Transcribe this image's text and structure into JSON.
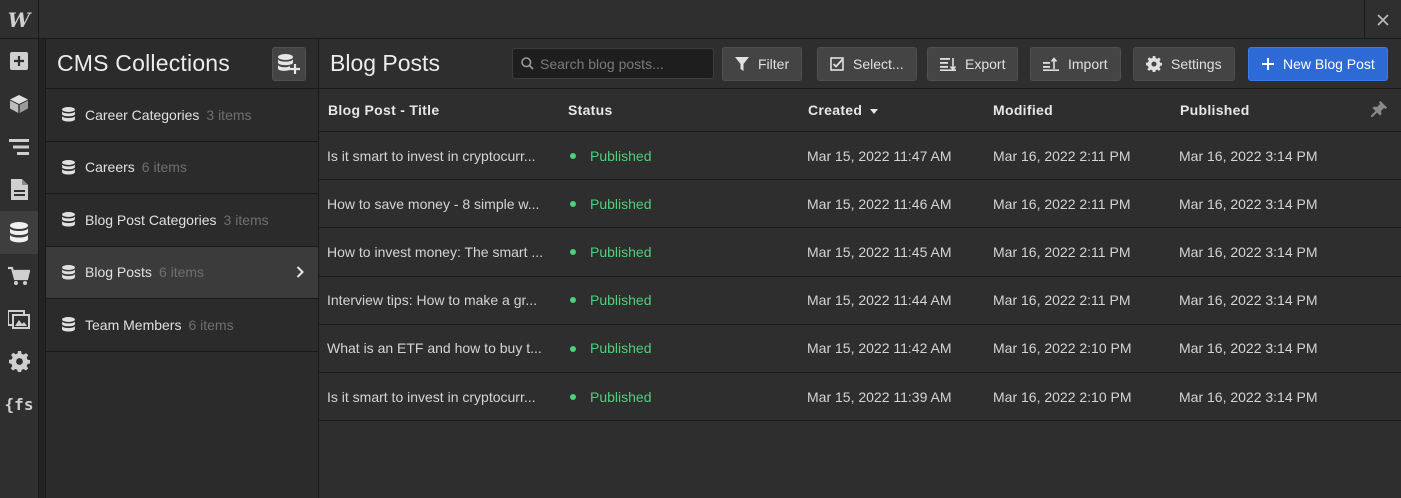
{
  "colors": {
    "accent": "#2d6ad6",
    "published": "#4cd07d"
  },
  "topbar": {
    "logo": "W",
    "close_icon": "close-icon"
  },
  "rail": {
    "items": [
      {
        "name": "add-icon"
      },
      {
        "name": "cube-icon"
      },
      {
        "name": "navigator-icon"
      },
      {
        "name": "page-icon"
      },
      {
        "name": "database-icon",
        "active": true
      },
      {
        "name": "cart-icon"
      },
      {
        "name": "images-icon"
      },
      {
        "name": "gear-icon"
      },
      {
        "name": "fs-icon",
        "label": "{fs"
      }
    ]
  },
  "collections": {
    "title": "CMS Collections",
    "items": [
      {
        "name": "Career Categories",
        "count": "3 items"
      },
      {
        "name": "Careers",
        "count": "6 items"
      },
      {
        "name": "Blog Post Categories",
        "count": "3 items"
      },
      {
        "name": "Blog Posts",
        "count": "6 items",
        "selected": true
      },
      {
        "name": "Team Members",
        "count": "6 items"
      }
    ]
  },
  "main": {
    "title": "Blog Posts",
    "search": {
      "placeholder": "Search blog posts...",
      "value": ""
    },
    "toolbar": {
      "filter": "Filter",
      "select": "Select...",
      "export": "Export",
      "import": "Import",
      "settings": "Settings",
      "new": "New Blog Post"
    },
    "table": {
      "headers": {
        "title": "Blog Post - Title",
        "status": "Status",
        "created": "Created",
        "modified": "Modified",
        "published": "Published"
      },
      "rows": [
        {
          "title": "Is it smart to invest in cryptocurr...",
          "status": "Published",
          "created": "Mar 15, 2022 11:47 AM",
          "modified": "Mar 16, 2022 2:11 PM",
          "published": "Mar 16, 2022 3:14 PM"
        },
        {
          "title": "How to save money - 8 simple w...",
          "status": "Published",
          "created": "Mar 15, 2022 11:46 AM",
          "modified": "Mar 16, 2022 2:11 PM",
          "published": "Mar 16, 2022 3:14 PM"
        },
        {
          "title": "How to invest money: The smart ...",
          "status": "Published",
          "created": "Mar 15, 2022 11:45 AM",
          "modified": "Mar 16, 2022 2:11 PM",
          "published": "Mar 16, 2022 3:14 PM"
        },
        {
          "title": "Interview tips: How to make a gr...",
          "status": "Published",
          "created": "Mar 15, 2022 11:44 AM",
          "modified": "Mar 16, 2022 2:11 PM",
          "published": "Mar 16, 2022 3:14 PM"
        },
        {
          "title": "What is an ETF and how to buy t...",
          "status": "Published",
          "created": "Mar 15, 2022 11:42 AM",
          "modified": "Mar 16, 2022 2:10 PM",
          "published": "Mar 16, 2022 3:14 PM"
        },
        {
          "title": "Is it smart to invest in cryptocurr...",
          "status": "Published",
          "created": "Mar 15, 2022 11:39 AM",
          "modified": "Mar 16, 2022 2:10 PM",
          "published": "Mar 16, 2022 3:14 PM"
        }
      ]
    }
  }
}
